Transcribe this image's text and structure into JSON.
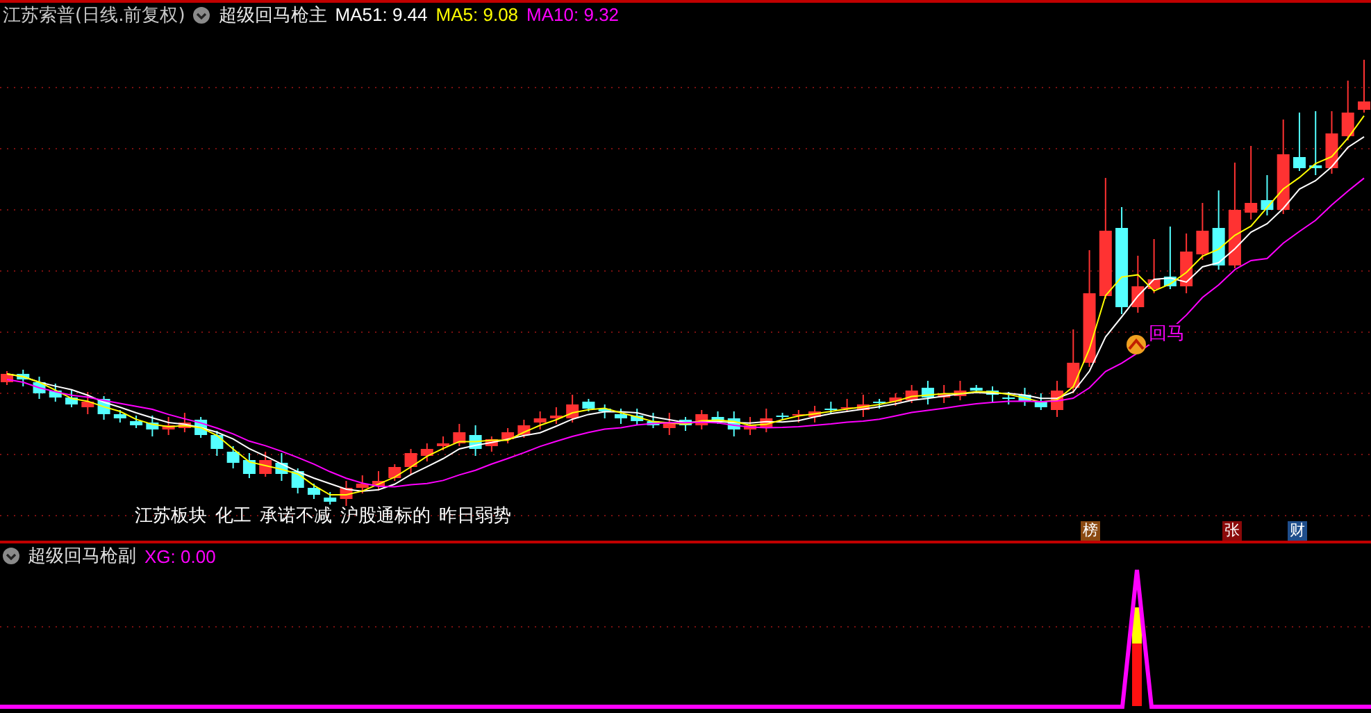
{
  "header": {
    "title": "江苏索普(日线.前复权)",
    "indicator": "超级回马枪主",
    "ma_readings": [
      {
        "label": "MA51: 9.44",
        "color": "#ffffff"
      },
      {
        "label": "MA5: 9.08",
        "color": "#ffff00"
      },
      {
        "label": "MA10: 9.32",
        "color": "#ff00ff"
      }
    ]
  },
  "main_chart": {
    "signal": {
      "label": "回马"
    },
    "tags": [
      "江苏板块",
      "化工",
      "承诺不减",
      "沪股通标的",
      "昨日弱势"
    ],
    "badges": [
      {
        "label": "榜",
        "color": "#8b4a12"
      },
      {
        "label": "张",
        "color": "#8b0a0a"
      },
      {
        "label": "财",
        "color": "#1f4e8c"
      }
    ]
  },
  "sub_panel": {
    "title": "超级回马枪副",
    "reading": "XG: 0.00"
  }
}
